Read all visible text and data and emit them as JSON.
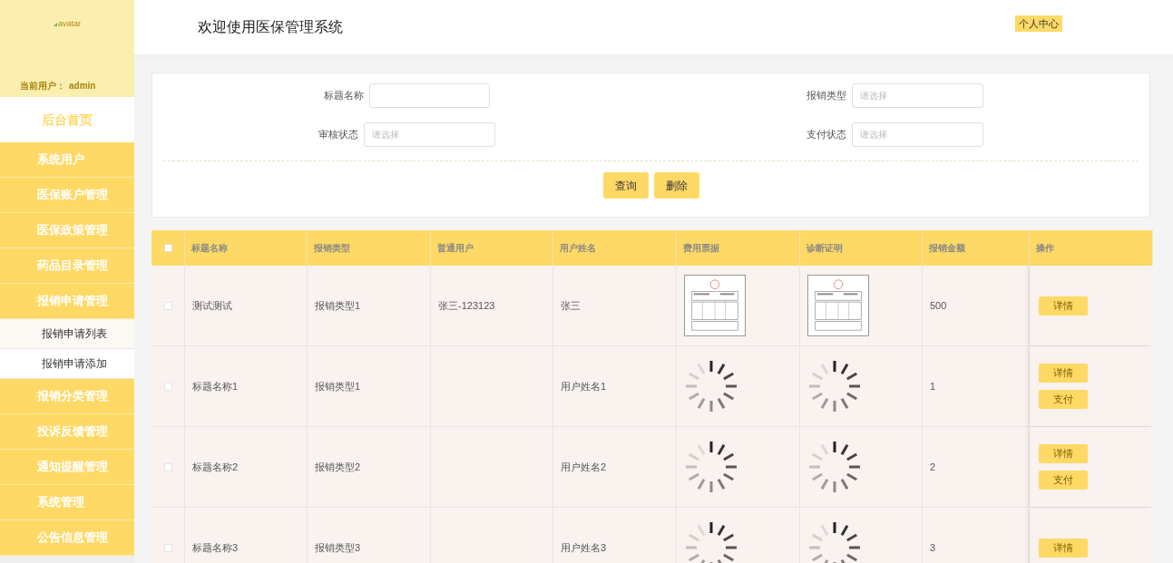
{
  "sidebar": {
    "avatar_alt": "avatar",
    "user_label": "当前用户：",
    "user_name": "admin",
    "home": "后台首页",
    "items": [
      {
        "label": "系统用户"
      },
      {
        "label": "医保账户管理"
      },
      {
        "label": "医保政策管理"
      },
      {
        "label": "药品目录管理"
      },
      {
        "label": "报销申请管理",
        "children": [
          {
            "label": "报销申请列表",
            "selected": true
          },
          {
            "label": "报销申请添加",
            "selected": false
          }
        ]
      },
      {
        "label": "报销分类管理"
      },
      {
        "label": "投诉反馈管理"
      },
      {
        "label": "通知提醒管理"
      },
      {
        "label": "系统管理"
      },
      {
        "label": "公告信息管理"
      }
    ]
  },
  "header": {
    "title": "欢迎使用医保管理系统",
    "user_center": "个人中心"
  },
  "filters": [
    {
      "label": "标题名称",
      "kind": "text"
    },
    {
      "label": "报销类型",
      "kind": "select",
      "placeholder": "请选择"
    },
    {
      "label": "审核状态",
      "kind": "select",
      "placeholder": "请选择"
    },
    {
      "label": "支付状态",
      "kind": "select",
      "placeholder": "请选择"
    }
  ],
  "buttons": [
    "查询",
    "删除"
  ],
  "table": {
    "columns": [
      "标题名称",
      "报销类型",
      "普通用户",
      "用户姓名",
      "费用票据",
      "诊断证明",
      "报销金额",
      "操作"
    ],
    "header_checked": false,
    "rows": [
      {
        "checked": false,
        "title": "测试测试",
        "type": "报销类型1",
        "user": "张三-123123",
        "name": "张三",
        "amount": "500",
        "actions": [
          "详情"
        ]
      },
      {
        "checked": false,
        "title": "标题名称1",
        "type": "报销类型1",
        "name": "用户姓名1",
        "receipt": {
          "kind": "loading"
        },
        "diagnosis": {
          "kind": "loading"
        },
        "amount": "1",
        "actions": [
          "详情",
          "支付"
        ]
      },
      {
        "checked": false,
        "title": "标题名称2",
        "type": "报销类型2",
        "name": "用户姓名2",
        "receipt": {
          "kind": "loading"
        },
        "diagnosis": {
          "kind": "loading"
        },
        "amount": "2",
        "actions": [
          "详情",
          "支付"
        ]
      },
      {
        "checked": false,
        "title": "标题名称3",
        "type": "报销类型3",
        "name": "用户姓名3",
        "receipt": {
          "kind": "loading"
        },
        "diagnosis": {
          "kind": "loading"
        },
        "amount": "3",
        "actions": [
          "详情"
        ]
      }
    ]
  }
}
